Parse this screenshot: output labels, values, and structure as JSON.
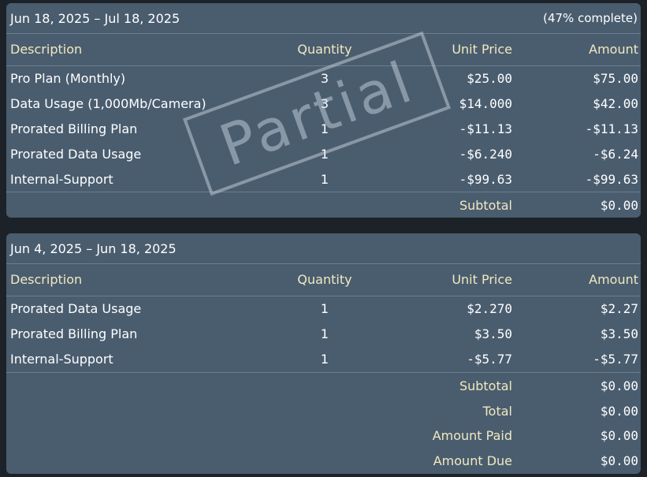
{
  "invoice": {
    "sections": [
      {
        "period": "Jun 18, 2025 – Jul 18, 2025",
        "progress": "(47% complete)",
        "stamp": "Partial",
        "headers": {
          "description": "Description",
          "quantity": "Quantity",
          "unit_price": "Unit Price",
          "amount": "Amount"
        },
        "rows": [
          {
            "description": "Pro Plan (Monthly)",
            "quantity": "3",
            "unit_price": "$25.00",
            "amount": "$75.00"
          },
          {
            "description": "Data Usage (1,000Mb/Camera)",
            "quantity": "3",
            "unit_price": "$14.000",
            "amount": "$42.00"
          },
          {
            "description": "Prorated Billing Plan",
            "quantity": "1",
            "unit_price": "-$11.13",
            "amount": "-$11.13"
          },
          {
            "description": "Prorated Data Usage",
            "quantity": "1",
            "unit_price": "-$6.240",
            "amount": "-$6.24"
          },
          {
            "description": "Internal-Support",
            "quantity": "1",
            "unit_price": "-$99.63",
            "amount": "-$99.63"
          }
        ],
        "subtotal_label": "Subtotal",
        "subtotal": "$0.00"
      },
      {
        "period": "Jun 4, 2025 – Jun 18, 2025",
        "headers": {
          "description": "Description",
          "quantity": "Quantity",
          "unit_price": "Unit Price",
          "amount": "Amount"
        },
        "rows": [
          {
            "description": "Prorated Data Usage",
            "quantity": "1",
            "unit_price": "$2.270",
            "amount": "$2.27"
          },
          {
            "description": "Prorated Billing Plan",
            "quantity": "1",
            "unit_price": "$3.50",
            "amount": "$3.50"
          },
          {
            "description": "Internal-Support",
            "quantity": "1",
            "unit_price": "-$5.77",
            "amount": "-$5.77"
          }
        ],
        "summary": [
          {
            "label": "Subtotal",
            "value": "$0.00"
          },
          {
            "label": "Total",
            "value": "$0.00"
          },
          {
            "label": "Amount Paid",
            "value": "$0.00"
          },
          {
            "label": "Amount Due",
            "value": "$0.00"
          }
        ]
      }
    ]
  },
  "colors": {
    "background": "#1c2227",
    "card": "#4a5d6f",
    "header_text": "#f2e8c0",
    "divider": "#6b7e8f"
  }
}
